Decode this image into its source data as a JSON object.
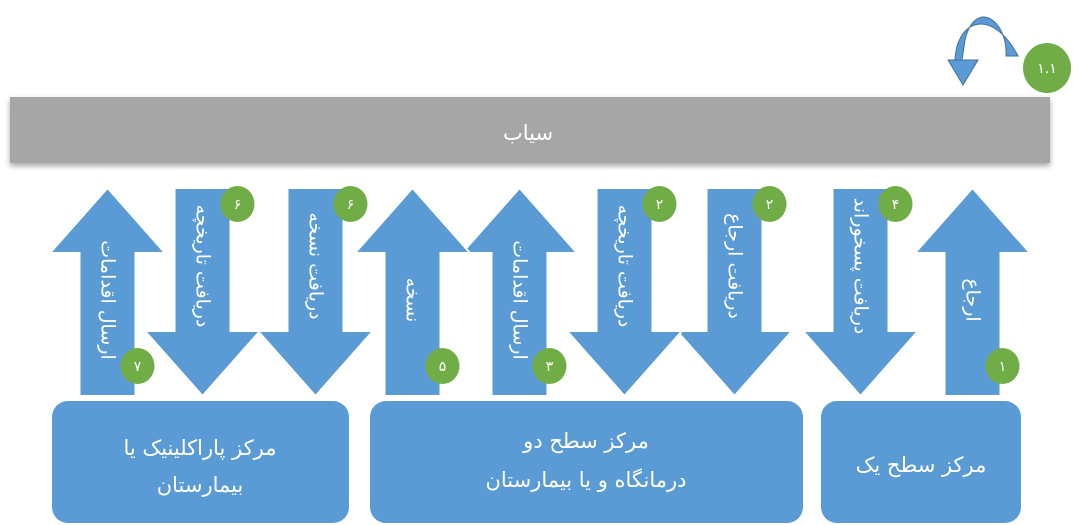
{
  "bar": {
    "label": "سیاب"
  },
  "loop_badge": "۱.۱",
  "colors": {
    "arrow": "#5b9bd5",
    "arrow_stroke": "#ffffff",
    "box": "#5b9bd5",
    "bar": "#a6a6a6",
    "badge": "#70ad47"
  },
  "arrows": [
    {
      "id": "a1",
      "direction": "up",
      "label": "ارجاع",
      "badge": "۱"
    },
    {
      "id": "a2",
      "direction": "down",
      "label": "دریافت پسخوراند",
      "badge": "۴"
    },
    {
      "id": "a3",
      "direction": "down",
      "label": "دریافت ارجاع",
      "badge": "۲"
    },
    {
      "id": "a4",
      "direction": "down",
      "label": "دریافت تاریخچه",
      "badge": "۲"
    },
    {
      "id": "a5",
      "direction": "up",
      "label": "ارسال اقدامات",
      "badge": "۳"
    },
    {
      "id": "a6",
      "direction": "up",
      "label": "نسخه",
      "badge": "۵"
    },
    {
      "id": "a7",
      "direction": "down",
      "label": "دریافت نسخه",
      "badge": "۶"
    },
    {
      "id": "a8",
      "direction": "down",
      "label": "دریافت تاریخچه",
      "badge": "۶"
    },
    {
      "id": "a9",
      "direction": "up",
      "label": "ارسال اقدامات",
      "badge": "۷"
    }
  ],
  "boxes": [
    {
      "id": "level1",
      "lines": [
        "مرکز سطح یک"
      ]
    },
    {
      "id": "level2",
      "lines": [
        "مرکز سطح دو",
        "درمانگاه و یا بیمارستان"
      ]
    },
    {
      "id": "para",
      "lines": [
        "مرکز پاراکلینیک یا",
        "بیمارستان"
      ]
    }
  ]
}
